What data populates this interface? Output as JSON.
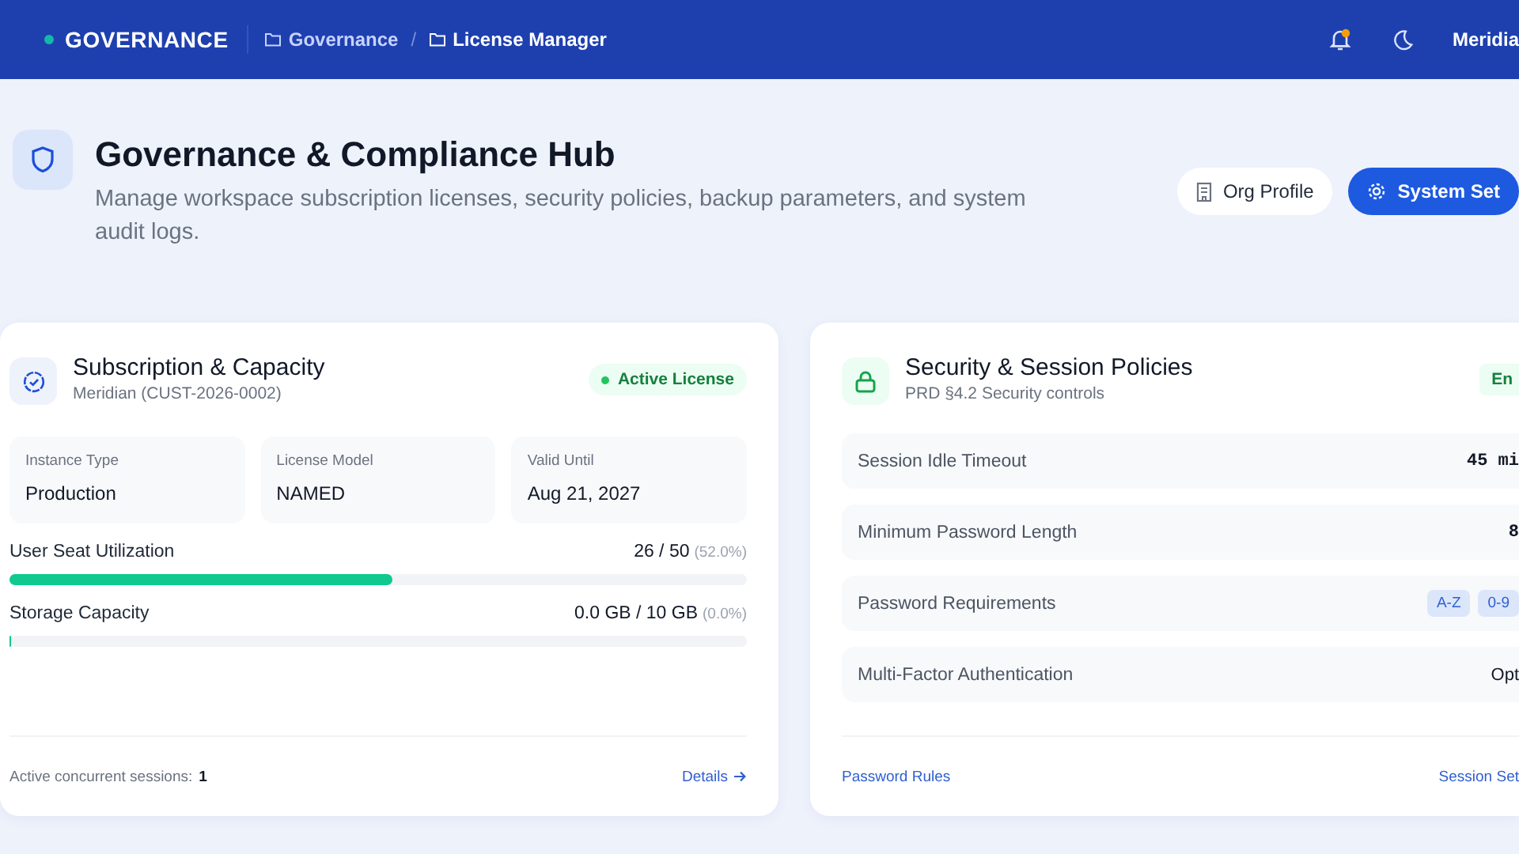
{
  "topbar": {
    "brand": "GOVERNANCE",
    "breadcrumbs": [
      "Governance",
      "License Manager"
    ],
    "separator": "/",
    "user": "Meridia"
  },
  "header": {
    "title": "Governance & Compliance Hub",
    "subtitle": "Manage workspace subscription licenses, security policies, backup parameters, and system audit logs.",
    "buttons": [
      {
        "label": "Org Profile",
        "kind": "secondary"
      },
      {
        "label": "System Set",
        "kind": "primary"
      }
    ]
  },
  "subscription": {
    "title": "Subscription & Capacity",
    "subtitle": "Meridian (CUST-2026-0002)",
    "badge": "Active License",
    "facts": [
      {
        "label": "Instance Type",
        "value": "Production"
      },
      {
        "label": "License Model",
        "value": "NAMED"
      },
      {
        "label": "Valid Until",
        "value": "Aug 21, 2027"
      }
    ],
    "meters": [
      {
        "name": "User Seat Utilization",
        "reading": "26 / 50",
        "percent": "(52.0%)",
        "level": 0.52
      },
      {
        "name": "Storage Capacity",
        "reading": "0.0 GB / 10 GB",
        "percent": "(0.0%)",
        "level": 0.0
      }
    ],
    "footer_label": "Active concurrent sessions:",
    "footer_value": "1",
    "link": "Details"
  },
  "security": {
    "title": "Security & Session Policies",
    "subtitle": "PRD §4.2 Security controls",
    "badge": "En",
    "policies": [
      {
        "name": "Session Idle Timeout",
        "kind": "mono",
        "value": "45 mi"
      },
      {
        "name": "Minimum Password Length",
        "kind": "mono",
        "value": "8"
      },
      {
        "name": "Password Requirements",
        "kind": "chips",
        "chips": [
          "A-Z",
          "0-9"
        ]
      },
      {
        "name": "Multi-Factor Authentication",
        "kind": "text",
        "value": "Opt"
      }
    ],
    "links": [
      "Password Rules",
      "Session Set"
    ]
  }
}
